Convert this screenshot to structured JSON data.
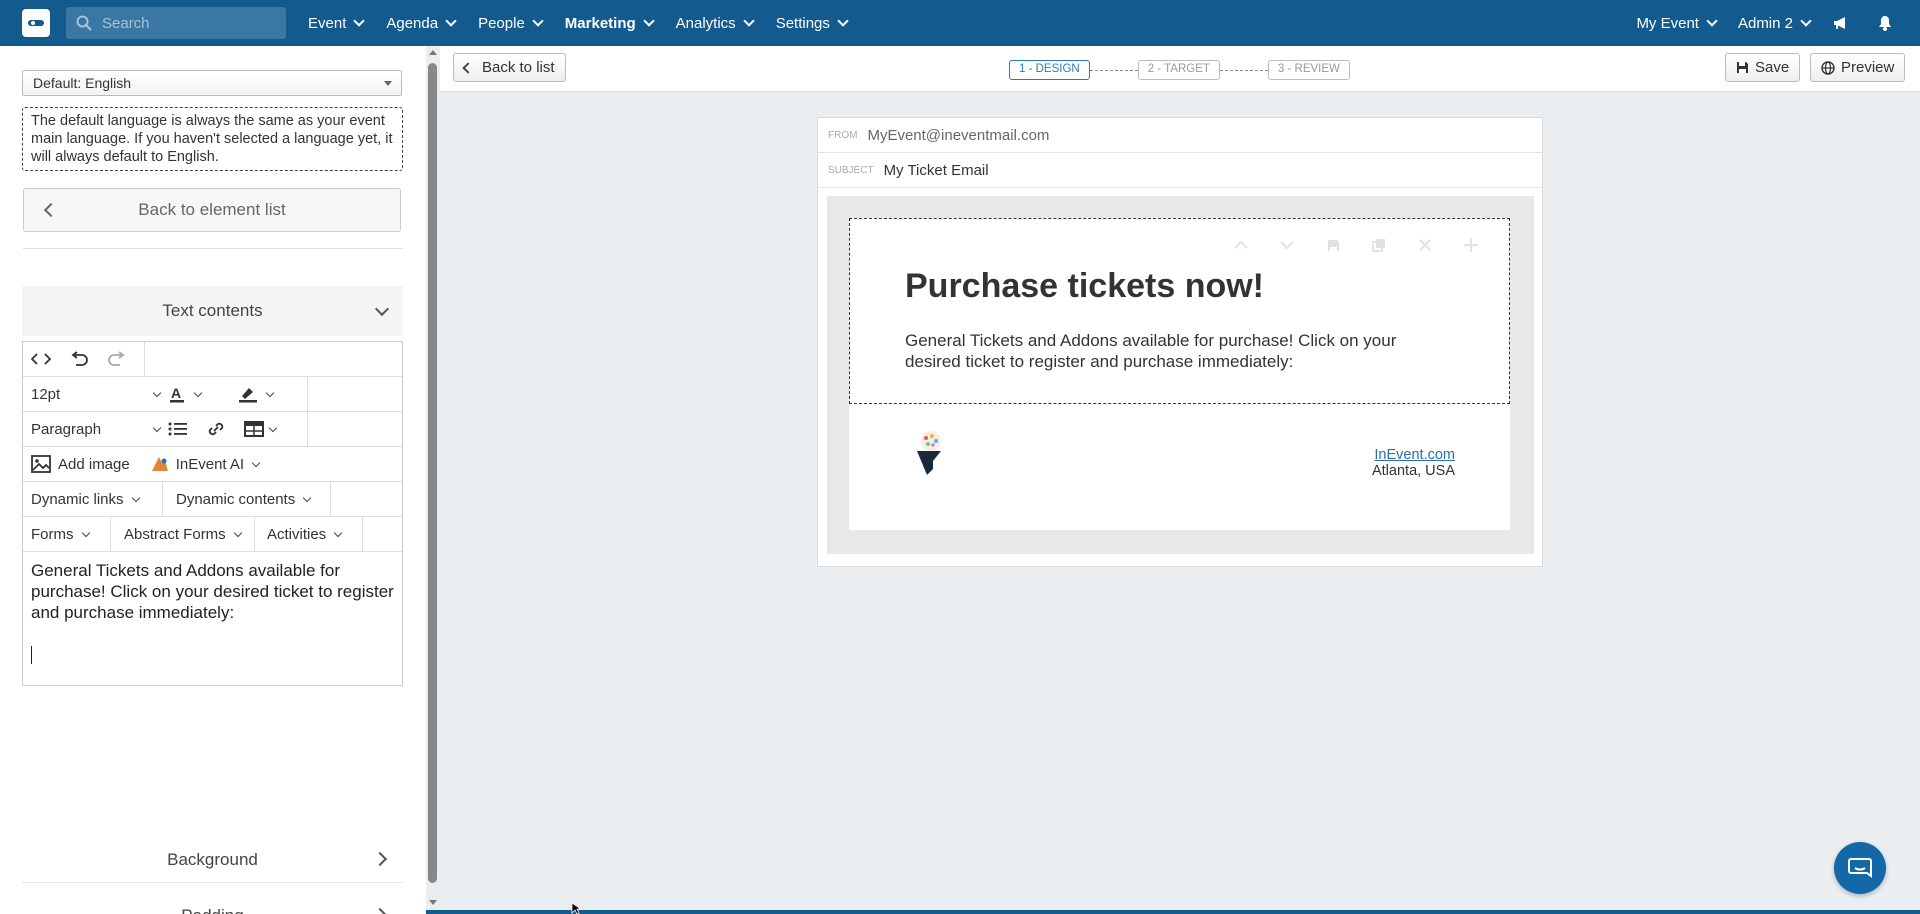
{
  "nav": {
    "search_placeholder": "Search",
    "items": [
      "Event",
      "Agenda",
      "People",
      "Marketing",
      "Analytics",
      "Settings"
    ],
    "active_item": "Marketing",
    "event_menu": "My Event",
    "user_menu": "Admin 2",
    "brand_color": "#135a8e"
  },
  "left": {
    "language_select": "Default: English",
    "language_note": "The default language is always the same as your event main language. If you haven't selected a language yet, it will always default to English.",
    "back_to_elements": "Back to element list",
    "text_contents_title": "Text contents",
    "font_size": "12pt",
    "block_format": "Paragraph",
    "add_image": "Add image",
    "inevent_ai": "InEvent AI",
    "dynamic_links": "Dynamic links",
    "dynamic_contents": "Dynamic contents",
    "forms": "Forms",
    "abstract_forms": "Abstract Forms",
    "activities": "Activities",
    "editor_text": "General Tickets and Addons available for purchase! Click on your desired ticket to register and purchase immediately:",
    "background_title": "Background",
    "padding_title": "Padding"
  },
  "toolbar": {
    "back_to_list": "Back to list",
    "steps": [
      "1 - DESIGN",
      "2 - TARGET",
      "3 - REVIEW"
    ],
    "save": "Save",
    "preview": "Preview"
  },
  "email": {
    "from_label": "FROM",
    "from_value": "MyEvent@ineventmail.com",
    "subject_label": "SUBJECT",
    "subject_value": "My Ticket Email",
    "heading": "Purchase tickets now!",
    "paragraph": "General Tickets and Addons available for purchase! Click on your desired ticket to register and purchase immediately:",
    "footer_link": "InEvent.com",
    "footer_address": "Atlanta, USA"
  }
}
